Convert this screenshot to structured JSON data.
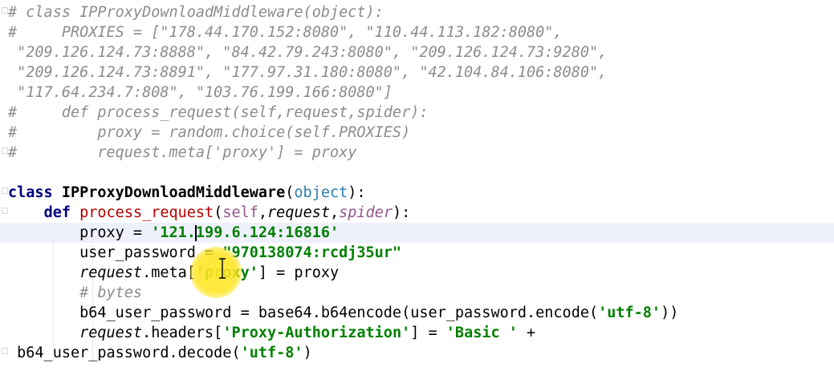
{
  "editor": {
    "lines": [
      [
        {
          "t": "# class IPProxyDownloadMiddleware(object):",
          "c": "cmt"
        }
      ],
      [
        {
          "t": "#     PROXIES = [\"178.44.170.152:8080\", \"110.44.113.182:8080\",",
          "c": "cmt"
        }
      ],
      [
        {
          "t": " \"209.126.124.73:8888\", \"84.42.79.243:8080\", \"209.126.124.73:9280\",",
          "c": "cmt"
        }
      ],
      [
        {
          "t": " \"209.126.124.73:8891\", \"177.97.31.180:8080\", \"42.104.84.106:8080\",",
          "c": "cmt"
        }
      ],
      [
        {
          "t": " \"117.64.234.7:808\", \"103.76.199.166:8080\"]",
          "c": "cmt"
        }
      ],
      [
        {
          "t": "#     def process_request(self,request,spider):",
          "c": "cmt"
        }
      ],
      [
        {
          "t": "#         proxy = random.choice(self.PROXIES)",
          "c": "cmt"
        }
      ],
      [
        {
          "t": "#         request.meta['proxy'] = proxy",
          "c": "cmt"
        }
      ],
      [
        {
          "t": "",
          "c": ""
        }
      ],
      [
        {
          "t": "class ",
          "c": "kw"
        },
        {
          "t": "IPProxyDownloadMiddleware",
          "c": "fn"
        },
        {
          "t": "(",
          "c": ""
        },
        {
          "t": "object",
          "c": "builtin"
        },
        {
          "t": "):",
          "c": ""
        }
      ],
      [
        {
          "t": "    ",
          "c": ""
        },
        {
          "t": "def ",
          "c": "kw"
        },
        {
          "t": "process_request",
          "c": "fnd"
        },
        {
          "t": "(",
          "c": ""
        },
        {
          "t": "self",
          "c": "selfp"
        },
        {
          "t": ",",
          "c": ""
        },
        {
          "t": "request",
          "c": "param"
        },
        {
          "t": ",",
          "c": ""
        },
        {
          "t": "spider",
          "c": "selfp param"
        },
        {
          "t": "):",
          "c": ""
        }
      ],
      [
        {
          "t": "        proxy = ",
          "c": ""
        },
        {
          "t": "'121.",
          "c": "str"
        },
        {
          "t": "",
          "c": "caret"
        },
        {
          "t": "199.6.124:16816'",
          "c": "str"
        }
      ],
      [
        {
          "t": "        user_password = ",
          "c": ""
        },
        {
          "t": "\"970138074:rcdj35ur\"",
          "c": "str"
        }
      ],
      [
        {
          "t": "        ",
          "c": ""
        },
        {
          "t": "request",
          "c": "param"
        },
        {
          "t": ".meta[",
          "c": ""
        },
        {
          "t": "'proxy'",
          "c": "str"
        },
        {
          "t": "] = proxy",
          "c": ""
        }
      ],
      [
        {
          "t": "        # bytes",
          "c": "cmt"
        }
      ],
      [
        {
          "t": "        b64_user_password = base64.b64encode(user_password.encode(",
          "c": ""
        },
        {
          "t": "'utf-8'",
          "c": "str"
        },
        {
          "t": "))",
          "c": ""
        }
      ],
      [
        {
          "t": "        ",
          "c": ""
        },
        {
          "t": "request",
          "c": "param"
        },
        {
          "t": ".headers[",
          "c": ""
        },
        {
          "t": "'Proxy-Authorization'",
          "c": "str"
        },
        {
          "t": "] = ",
          "c": ""
        },
        {
          "t": "'Basic '",
          "c": "str"
        },
        {
          "t": " +",
          "c": ""
        }
      ],
      [
        {
          "t": " b64_user_password.decode(",
          "c": ""
        },
        {
          "t": "'utf-8'",
          "c": "str"
        },
        {
          "t": ")",
          "c": ""
        }
      ]
    ]
  }
}
